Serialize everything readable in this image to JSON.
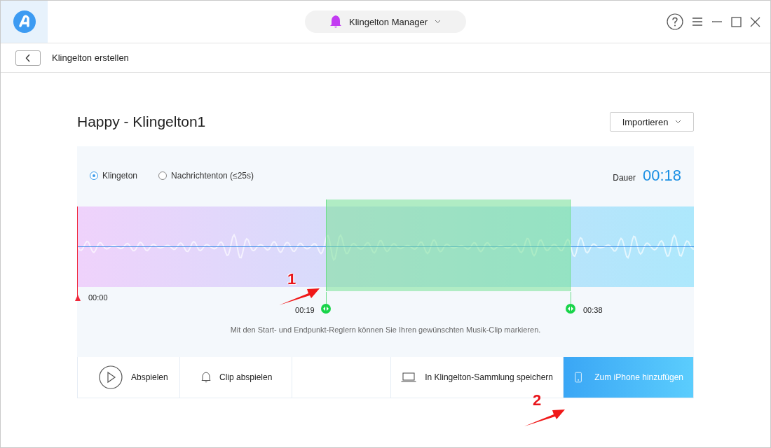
{
  "header": {
    "app_menu": "Klingelton Manager"
  },
  "subheader": {
    "title": "Klingelton erstellen"
  },
  "ringtone": {
    "title": "Happy - Klingelton1",
    "import_button": "Importieren"
  },
  "modes": [
    {
      "label": "Klingeton",
      "selected": true
    },
    {
      "label": "Nachrichtenton (≤25s)",
      "selected": false
    }
  ],
  "duration": {
    "label": "Dauer",
    "value": "00:18"
  },
  "playhead": {
    "time": "00:00",
    "level": 0
  },
  "handles": [
    {
      "time": "00:19",
      "level": 0.403
    },
    {
      "time": "00:38",
      "level": 0.8
    }
  ],
  "hint": "Mit den Start- und Endpunkt-Reglern können Sie Ihren gewünschten Musik-Clip markieren.",
  "left_actions": [
    {
      "label": "Abspielen",
      "kind": "play",
      "primary": false
    },
    {
      "label": "Clip abspielen",
      "kind": "bell",
      "primary": false
    }
  ],
  "right_actions": [
    {
      "label": "In Klingelton-Sammlung speichern",
      "kind": "laptop",
      "primary": false
    },
    {
      "label": "Zum iPhone hinzufügen",
      "kind": "phone",
      "primary": true
    }
  ],
  "annotations": [
    {
      "number": "1"
    },
    {
      "number": "2"
    }
  ]
}
